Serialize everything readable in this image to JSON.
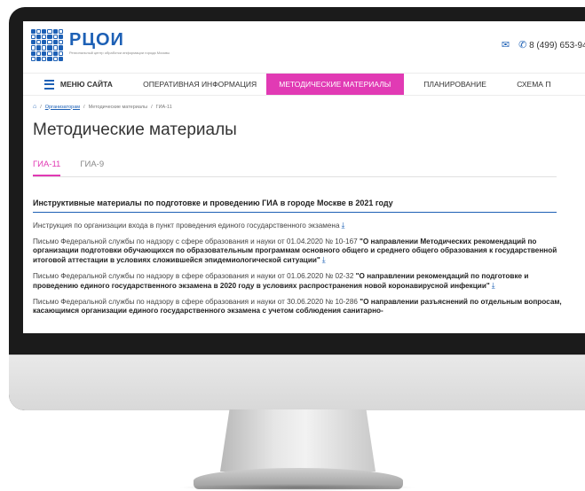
{
  "header": {
    "logo_title": "РЦОИ",
    "logo_subtitle": "Региональный центр обработки информации города Москвы",
    "phone": "8 (499) 653-94-"
  },
  "nav": {
    "menu_label": "МЕНЮ САЙТА",
    "items": [
      "ОПЕРАТИВНАЯ ИНФОРМАЦИЯ",
      "МЕТОДИЧЕСКИЕ МАТЕРИАЛЫ",
      "ПЛАНИРОВАНИЕ",
      "СХЕМА П"
    ],
    "active_color": "#e13ab4"
  },
  "breadcrumb": {
    "items": [
      "Организаторам",
      "Методические материалы",
      "ГИА-11"
    ]
  },
  "page": {
    "title": "Методические материалы",
    "tabs": [
      "ГИА-11",
      "ГИА-9"
    ],
    "section_title": "Инструктивные материалы по подготовке и проведению ГИА в городе Москве в 2021 году"
  },
  "documents": [
    {
      "plain": "Инструкция по организации входа в пункт проведения единого государственного экзамена",
      "bold": ""
    },
    {
      "plain": "Письмо Федеральной службы по надзору с сфере образования и науки от 01.04.2020 № 10-167 ",
      "bold": "\"О направлении Методических рекомендаций по организации подготовки обучающихся по образовательным программам основного общего и среднего общего образования к государственной итоговой аттестации в условиях сложившейся эпидемиологической ситуации\""
    },
    {
      "plain": "Письмо Федеральной службы по надзору в сфере образования и науки от 01.06.2020 № 02-32 ",
      "bold": "\"О направлении рекомендаций по подготовке и проведению единого государственного экзамена в 2020 году в условиях распространения новой коронавирусной инфекции\""
    },
    {
      "plain": "Письмо Федеральной службы по надзору в сфере образования и науки от 30.06.2020 № 10-286 ",
      "bold": "\"О направлении разъяснений по отдельным вопросам, касающимся организации единого государственного экзамена с учетом соблюдения санитарно-"
    }
  ],
  "icons": {
    "mail": "mail-icon",
    "phone": "phone-icon",
    "download": "download-icon",
    "home": "home-icon"
  },
  "colors": {
    "brand_blue": "#1d60b5",
    "accent_pink": "#e13ab4"
  }
}
